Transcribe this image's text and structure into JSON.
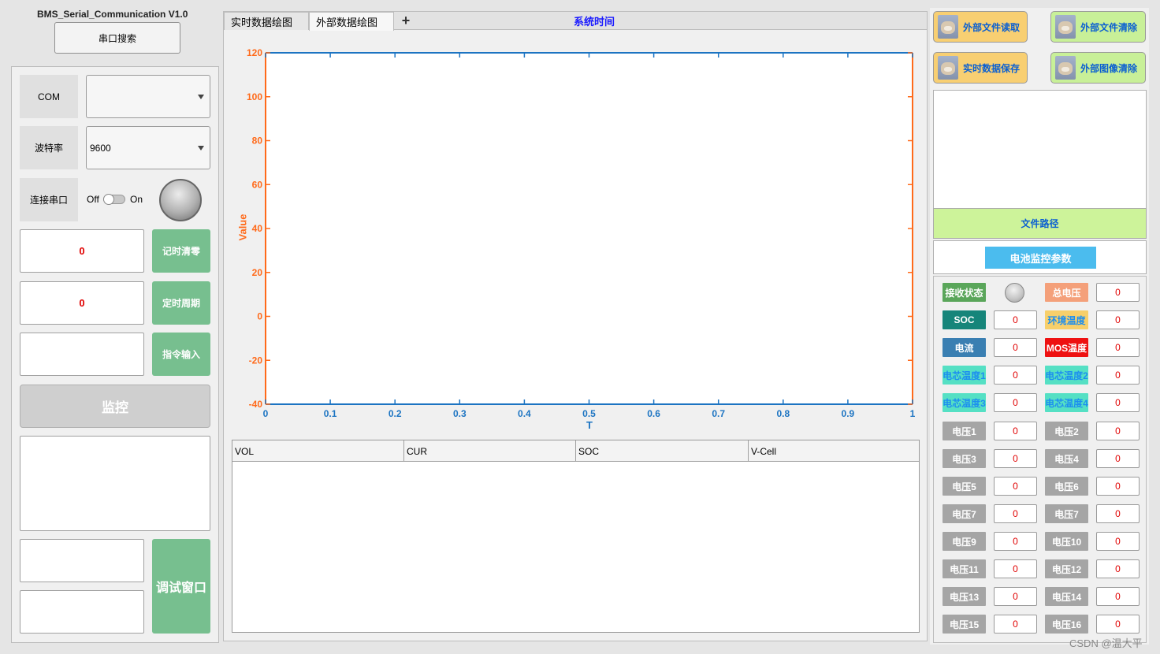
{
  "app_title": "BMS_Serial_Communication V1.0",
  "left": {
    "port_search": "串口搜索",
    "com_label": "COM",
    "com_value": "",
    "baud_label": "波特率",
    "baud_value": "9600",
    "connect_label": "连接串口",
    "switch_off": "Off",
    "switch_on": "On",
    "counter1": "0",
    "counter2": "0",
    "btn_clear_timer": "记时清零",
    "btn_timer_period": "定时周期",
    "btn_cmd_input": "指令输入",
    "cmd_value": "",
    "btn_monitor": "监控",
    "btn_debug": "调试窗口"
  },
  "center": {
    "tabs": [
      "实时数据绘图",
      "外部数据绘图"
    ],
    "add_tab": "+",
    "system_time": "系统时间",
    "table_headers": [
      "VOL",
      "CUR",
      "SOC",
      "V-Cell"
    ]
  },
  "chart_data": {
    "type": "line",
    "xlabel": "T",
    "ylabel": "Value",
    "xlim": [
      0,
      1
    ],
    "ylim": [
      -40,
      120
    ],
    "xticks": [
      "0",
      "0.1",
      "0.2",
      "0.3",
      "0.4",
      "0.5",
      "0.6",
      "0.7",
      "0.8",
      "0.9",
      "1"
    ],
    "yticks": [
      "120",
      "100",
      "80",
      "60",
      "40",
      "20",
      "0",
      "-20",
      "-40"
    ],
    "series": [],
    "colors": {
      "x_axis": "#1c74c2",
      "y_axis": "#ff6a1a"
    }
  },
  "right": {
    "btn_read_file": "外部文件读取",
    "btn_clear_file": "外部文件清除",
    "btn_save_realtime": "实时数据保存",
    "btn_clear_image": "外部图像清除",
    "file_path_label": "文件路径",
    "battery_params_title": "电池监控参数",
    "params": [
      {
        "label": "接收状态",
        "color": "#5aa65a",
        "value": "",
        "lamp": true
      },
      {
        "label": "总电压",
        "color": "#f4a07a",
        "value": "0"
      },
      {
        "label": "SOC",
        "color": "#16857a",
        "value": "0"
      },
      {
        "label": "环境温度",
        "color": "#f7cf6a",
        "text_color": "#1c8ef0",
        "value": "0"
      },
      {
        "label": "电流",
        "color": "#3a7fb2",
        "value": "0"
      },
      {
        "label": "MOS温度",
        "color": "#ee1111",
        "value": "0"
      },
      {
        "label": "电芯温度1",
        "color": "#55e0c4",
        "text_color": "#1c8ef0",
        "value": "0"
      },
      {
        "label": "电芯温度2",
        "color": "#55e0c4",
        "text_color": "#1c8ef0",
        "value": "0"
      },
      {
        "label": "电芯温度3",
        "color": "#55e0c4",
        "text_color": "#1c8ef0",
        "value": "0"
      },
      {
        "label": "电芯温度4",
        "color": "#55e0c4",
        "text_color": "#1c8ef0",
        "value": "0"
      },
      {
        "label": "电压1",
        "color": "#a5a5a5",
        "value": "0"
      },
      {
        "label": "电压2",
        "color": "#a5a5a5",
        "value": "0"
      },
      {
        "label": "电压3",
        "color": "#a5a5a5",
        "value": "0"
      },
      {
        "label": "电压4",
        "color": "#a5a5a5",
        "value": "0"
      },
      {
        "label": "电压5",
        "color": "#a5a5a5",
        "value": "0"
      },
      {
        "label": "电压6",
        "color": "#a5a5a5",
        "value": "0"
      },
      {
        "label": "电压7",
        "color": "#a5a5a5",
        "value": "0"
      },
      {
        "label": "电压7",
        "color": "#a5a5a5",
        "value": "0"
      },
      {
        "label": "电压9",
        "color": "#a5a5a5",
        "value": "0"
      },
      {
        "label": "电压10",
        "color": "#a5a5a5",
        "value": "0"
      },
      {
        "label": "电压11",
        "color": "#a5a5a5",
        "value": "0"
      },
      {
        "label": "电压12",
        "color": "#a5a5a5",
        "value": "0"
      },
      {
        "label": "电压13",
        "color": "#a5a5a5",
        "value": "0"
      },
      {
        "label": "电压14",
        "color": "#a5a5a5",
        "value": "0"
      },
      {
        "label": "电压15",
        "color": "#a5a5a5",
        "value": "0"
      },
      {
        "label": "电压16",
        "color": "#a5a5a5",
        "value": "0"
      }
    ]
  },
  "watermark": "CSDN @温大平"
}
